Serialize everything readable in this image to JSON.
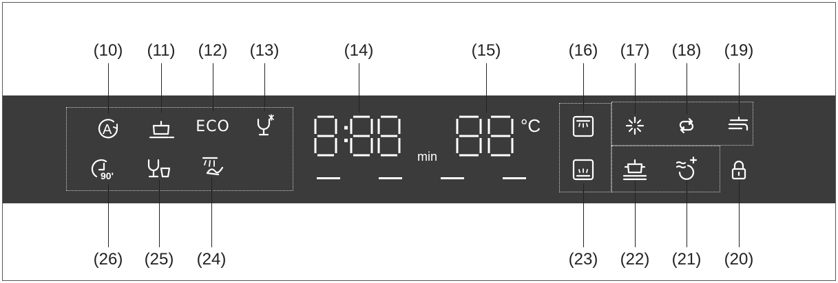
{
  "callouts": {
    "c10": "(10)",
    "c11": "(11)",
    "c12": "(12)",
    "c13": "(13)",
    "c14": "(14)",
    "c15": "(15)",
    "c16": "(16)",
    "c17": "(17)",
    "c18": "(18)",
    "c19": "(19)",
    "c20": "(20)",
    "c21": "(21)",
    "c22": "(22)",
    "c23": "(23)",
    "c24": "(24)",
    "c25": "(25)",
    "c26": "(26)"
  },
  "display": {
    "eco_label": "ECO",
    "time_digits": "8:88",
    "time_unit": "min",
    "temp_digits": "88",
    "temp_unit": "°C",
    "timer_90_label": "90'"
  },
  "icons": {
    "auto": "auto-program-icon",
    "intensive": "intensive-pot-icon",
    "eco": "eco-text-icon",
    "glass": "glass-care-icon",
    "quick90": "quick-90-min-icon",
    "glasses": "glasses-cups-icon",
    "prewash": "prewash-spray-icon",
    "upper_basket": "upper-basket-icon",
    "lower_basket": "lower-basket-icon",
    "rinse_aid": "rinse-aid-icon",
    "regen_salt": "salt-regeneration-icon",
    "water_tap": "water-tap-icon",
    "lock": "child-lock-icon",
    "extra_dry": "extra-dry-icon",
    "heavy_pot": "heavy-pot-icon"
  },
  "colors": {
    "panel": "#3b3b3b",
    "icon": "#ffffff",
    "text": "#222222"
  }
}
